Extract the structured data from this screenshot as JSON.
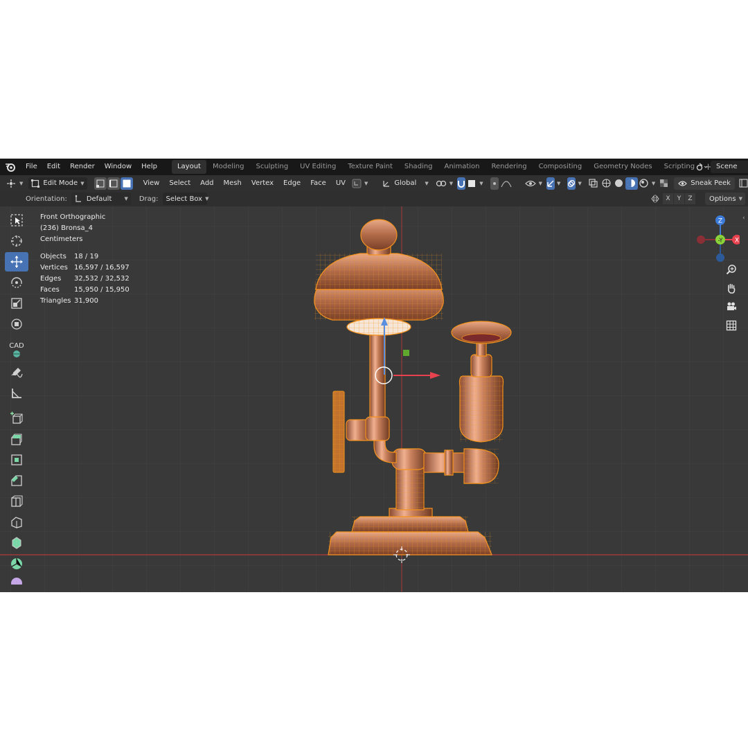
{
  "menu": {
    "items": [
      "File",
      "Edit",
      "Render",
      "Window",
      "Help"
    ]
  },
  "workspaces": {
    "tabs": [
      "Layout",
      "Modeling",
      "Sculpting",
      "UV Editing",
      "Texture Paint",
      "Shading",
      "Animation",
      "Rendering",
      "Compositing",
      "Geometry Nodes",
      "Scripting"
    ],
    "active": "Layout",
    "add_label": "+"
  },
  "scene": {
    "name": "Scene"
  },
  "header": {
    "mode": "Edit Mode",
    "menus": [
      "View",
      "Select",
      "Add",
      "Mesh",
      "Vertex",
      "Edge",
      "Face",
      "UV"
    ],
    "transform_orientation": "Global",
    "sneak_peek": "Sneak Peek"
  },
  "toolsettings": {
    "orientation_label": "Orientation:",
    "orientation_value": "Default",
    "drag_label": "Drag:",
    "drag_value": "Select Box",
    "axis_x": "X",
    "axis_y": "Y",
    "axis_z": "Z",
    "options_label": "Options"
  },
  "toolbar": {
    "cad_label": "CAD"
  },
  "viewport": {
    "view_name": "Front Orthographic",
    "object_name": "(236) Bronsa_4",
    "units": "Centimeters",
    "stats": [
      {
        "label": "Objects",
        "value": "18 / 19"
      },
      {
        "label": "Vertices",
        "value": "16,597 / 16,597"
      },
      {
        "label": "Edges",
        "value": "32,532 / 32,532"
      },
      {
        "label": "Faces",
        "value": "15,950 / 15,950"
      },
      {
        "label": "Triangles",
        "value": "31,900"
      }
    ]
  },
  "gizmo": {
    "z": "Z",
    "y": "-Y",
    "x": "X"
  },
  "colors": {
    "selection": "#f5931e",
    "active_tool": "#4772b3",
    "axis_x": "#e8424f",
    "axis_y": "#8bd33a",
    "axis_z": "#3c7bd8",
    "copper": "#c77a5a"
  }
}
